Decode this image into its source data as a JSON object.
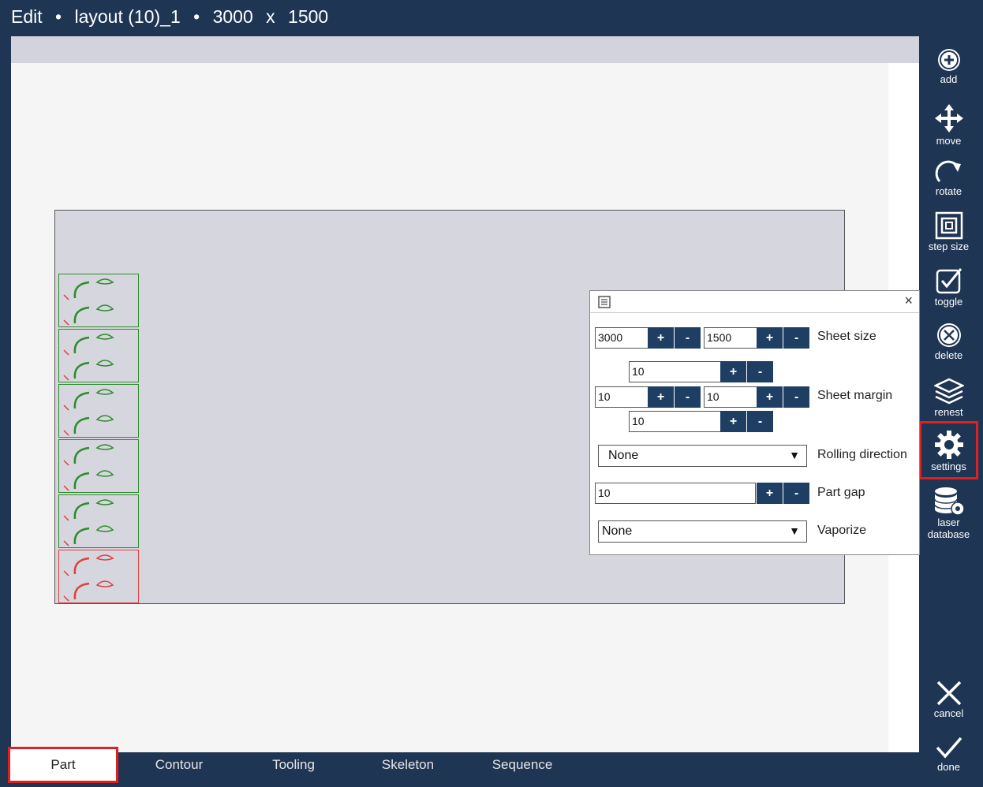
{
  "title": {
    "mode": "Edit",
    "separator1": "•",
    "layout_name": "layout (10)_1",
    "separator2": "•",
    "width": "3000",
    "x": "x",
    "height": "1500"
  },
  "toolbar": {
    "add": "add",
    "move": "move",
    "rotate": "rotate",
    "step_size": "step size",
    "toggle": "toggle",
    "delete": "delete",
    "renest": "renest",
    "settings": "settings",
    "laser_database": "laser database",
    "cancel": "cancel",
    "done": "done"
  },
  "tabs": [
    "Part",
    "Contour",
    "Tooling",
    "Skeleton",
    "Sequence"
  ],
  "active_tab": "Part",
  "settings_dialog": {
    "sheet_size_width": "3000",
    "sheet_size_height": "1500",
    "sheet_size_label": "Sheet size",
    "margin_top": "10",
    "margin_left": "10",
    "margin_right": "10",
    "margin_bottom": "10",
    "sheet_margin_label": "Sheet margin",
    "rolling_direction_value": "None",
    "rolling_direction_label": "Rolling direction",
    "part_gap_value": "10",
    "part_gap_label": "Part gap",
    "vaporize_value": "None",
    "vaporize_label": "Vaporize",
    "plus": "+",
    "minus": "-",
    "close": "×",
    "dropdown_arrow": "▼"
  },
  "colors": {
    "background": "#1e3553",
    "button": "#1e3f63",
    "highlight": "#e02020",
    "part_ok": "#2e8b2e",
    "part_error": "#e04040"
  }
}
